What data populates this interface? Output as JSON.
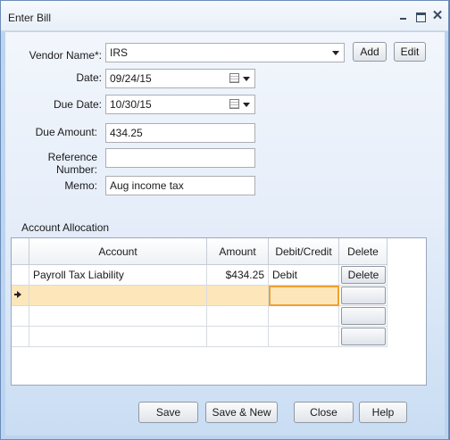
{
  "window": {
    "title": "Enter Bill",
    "close_glyph": "✕"
  },
  "form": {
    "vendor_label": "Vendor Name*:",
    "vendor_value": "IRS",
    "date_label": "Date:",
    "date_value": "09/24/15",
    "due_date_label": "Due Date:",
    "due_date_value": "10/30/15",
    "due_amount_label": "Due Amount:",
    "due_amount_value": "434.25",
    "reference_label": "Reference Number:",
    "reference_value": "",
    "memo_label": "Memo:",
    "memo_value": "Aug income tax",
    "add_label": "Add",
    "edit_label": "Edit"
  },
  "allocation": {
    "title": "Account Allocation",
    "columns": [
      "Account",
      "Amount",
      "Debit/Credit",
      "Delete"
    ],
    "rows": [
      {
        "account": "Payroll Tax Liability",
        "amount": "$434.25",
        "debit_credit": "Debit",
        "delete_label": "Delete"
      }
    ]
  },
  "footer": {
    "save_label": "Save",
    "save_new_label": "Save & New",
    "close_label": "Close",
    "help_label": "Help"
  }
}
